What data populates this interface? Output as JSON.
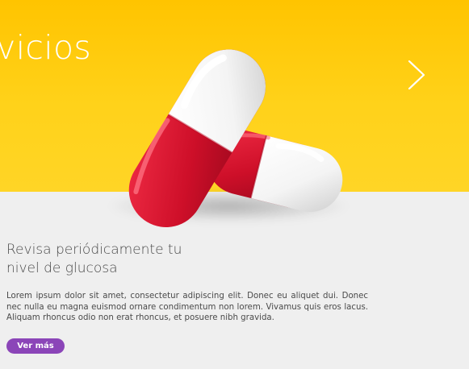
{
  "hero": {
    "title": "rvicios",
    "next_icon": "chevron-right-icon",
    "background_color": "#ffc400",
    "image": "red-and-white-capsules"
  },
  "article": {
    "headline": "Revisa periódicamente tu nivel de glucosa",
    "body": "Lorem ipsum dolor sit amet, consectetur adipiscing elit. Donec eu aliquet dui. Donec nec nulla eu magna euismod ornare condimentum non lorem. Vivamus quis eros lacus. Aliquam rhoncus odio non erat rhoncus, et posuere nibh gravida.",
    "button_label": "Ver más",
    "button_color": "#8b45b8"
  }
}
